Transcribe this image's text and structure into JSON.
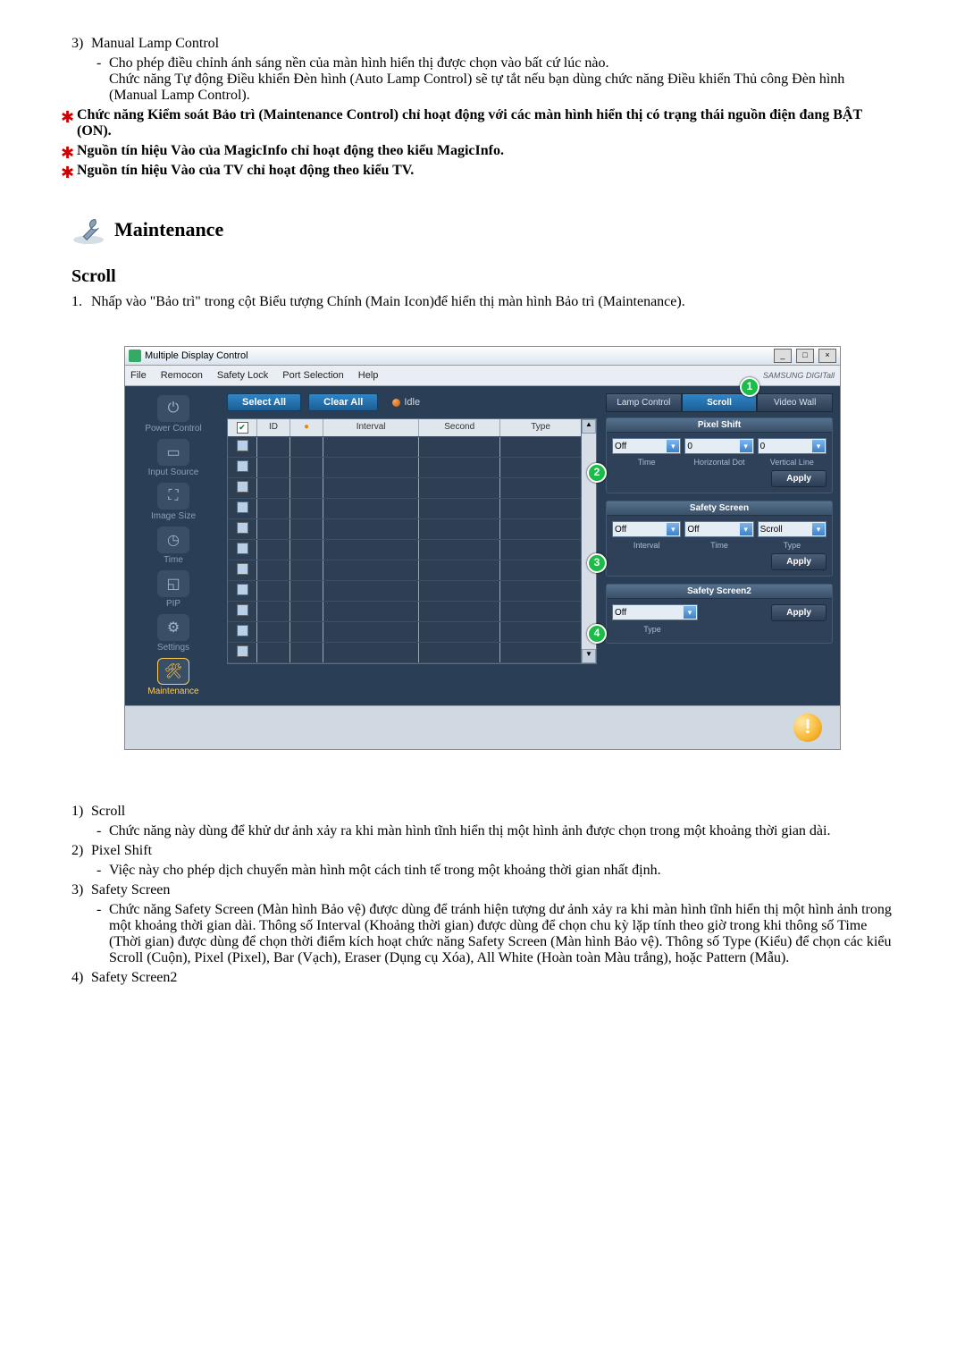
{
  "top": {
    "item3_num": "3)",
    "item3_title": "Manual Lamp Control",
    "item3_dash": "-",
    "item3_line1": "Cho phép điều chỉnh ánh sáng nền của màn hình hiển thị được chọn vào bất cứ lúc nào.",
    "item3_line2": "Chức năng Tự động Điều khiển Đèn hình (Auto Lamp Control) sẽ tự tắt nếu bạn dùng chức năng Điều khiển Thủ công Đèn hình (Manual Lamp Control).",
    "star1": "Chức năng Kiểm soát Bảo trì (Maintenance Control) chỉ hoạt động với các màn hình hiển thị có trạng thái nguồn điện đang BẬT (ON).",
    "star2": "Nguồn tín hiệu Vào của MagicInfo chỉ hoạt động theo kiểu MagicInfo.",
    "star3": "Nguồn tín hiệu Vào của TV chỉ hoạt động theo kiểu TV."
  },
  "maint_header": "Maintenance",
  "scroll_header": "Scroll",
  "scroll_item_num": "1.",
  "scroll_item_text": "Nhấp vào \"Bảo trì\" trong cột Biểu tượng Chính (Main Icon)để hiển thị màn hình Bảo trì (Maintenance).",
  "app": {
    "title": "Multiple Display Control",
    "menu": [
      "File",
      "Remocon",
      "Safety Lock",
      "Port Selection",
      "Help"
    ],
    "brand": "SAMSUNG DIGITall",
    "select_all": "Select All",
    "clear_all": "Clear All",
    "idle": "Idle",
    "nav": {
      "power": "Power Control",
      "input": "Input Source",
      "image": "Image Size",
      "time": "Time",
      "pip": "PIP",
      "settings": "Settings",
      "maint": "Maintenance"
    },
    "grid_head": {
      "id": "ID",
      "interval": "Interval",
      "second": "Second",
      "type": "Type"
    },
    "grid_status_icon": "●",
    "tabs": {
      "lamp": "Lamp Control",
      "scroll": "Scroll",
      "video": "Video Wall"
    },
    "pixel_shift": {
      "title": "Pixel Shift",
      "off": "Off",
      "v1": "0",
      "v2": "0",
      "sub1": "Time",
      "sub2": "Horizontal Dot",
      "sub3": "Vertical Line",
      "apply": "Apply"
    },
    "safety_screen": {
      "title": "Safety Screen",
      "off1": "Off",
      "off2": "Off",
      "type": "Scroll",
      "sub1": "Interval",
      "sub2": "Time",
      "sub3": "Type",
      "apply": "Apply"
    },
    "safety_screen2": {
      "title": "Safety Screen2",
      "off": "Off",
      "sub": "Type",
      "apply": "Apply"
    },
    "callouts": {
      "c1": "1",
      "c2": "2",
      "c3": "3",
      "c4": "4"
    }
  },
  "bottom": {
    "i1_num": "1)",
    "i1_title": "Scroll",
    "i1_dash": "-",
    "i1_text": "Chức năng này dùng để khử dư ảnh xảy ra khi màn hình tĩnh hiển thị một hình ảnh được chọn trong một khoảng thời gian dài.",
    "i2_num": "2)",
    "i2_title": "Pixel Shift",
    "i2_dash": "-",
    "i2_text": "Việc này cho phép dịch chuyển màn hình một cách tinh tế trong một khoảng thời gian nhất định.",
    "i3_num": "3)",
    "i3_title": "Safety Screen",
    "i3_dash": "-",
    "i3_text": "Chức năng Safety Screen (Màn hình Bảo vệ) được dùng để tránh hiện tượng dư ảnh xảy ra khi màn hình tĩnh hiển thị một hình ảnh trong một khoảng thời gian dài. Thông số Interval (Khoảng thời gian) được dùng để chọn chu kỳ lặp tính theo giờ trong khi thông số Time (Thời gian) được dùng để chọn thời điểm kích hoạt chức năng Safety Screen (Màn hình Bảo vệ). Thông số Type (Kiểu) để chọn các kiểu Scroll (Cuộn), Pixel (Pixel), Bar (Vạch), Eraser (Dụng cụ Xóa), All White (Hoàn toàn Màu trắng), hoặc Pattern (Mẫu).",
    "i4_num": "4)",
    "i4_title": "Safety Screen2"
  }
}
